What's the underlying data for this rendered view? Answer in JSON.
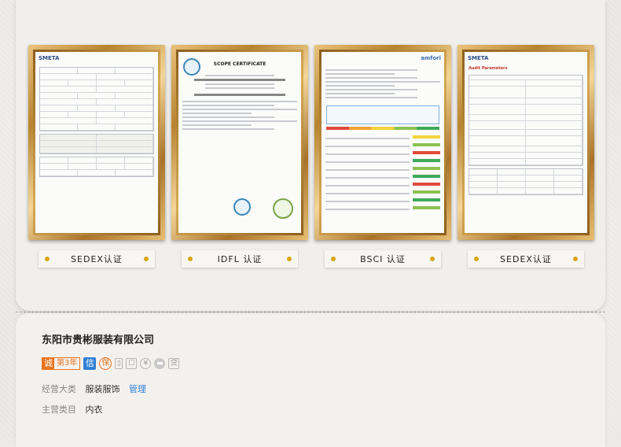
{
  "certificates": [
    {
      "label": "SEDEX认证",
      "doc_brand": "SMETA",
      "doc_title": ""
    },
    {
      "label": "IDFL 认证",
      "doc_brand": "",
      "doc_title": "SCOPE CERTIFICATE"
    },
    {
      "label": "BSCI 认证",
      "doc_brand": "amfori",
      "doc_title": ""
    },
    {
      "label": "SEDEX认证",
      "doc_brand": "SMETA",
      "doc_title": "Audit Parameters"
    }
  ],
  "company": {
    "name": "东阳市贵彬服装有限公司",
    "badges": {
      "cheng": "诚",
      "years": "第3年",
      "xin": "信",
      "bao": "保",
      "icons": [
        "phone-icon",
        "cert-icon",
        "yuan-icon",
        "message-icon",
        "loan-icon"
      ],
      "yuan": "¥",
      "loan": "贷"
    },
    "business_label": "经营大类",
    "business_value": "服装服饰",
    "manage_link": "管理",
    "category_label": "主营类目",
    "category_value": "内衣"
  },
  "colors": {
    "accent_orange": "#e8741e",
    "accent_blue": "#2f7fd6",
    "frame_gold": "#c9973f",
    "label_dot": "#d9a514"
  }
}
